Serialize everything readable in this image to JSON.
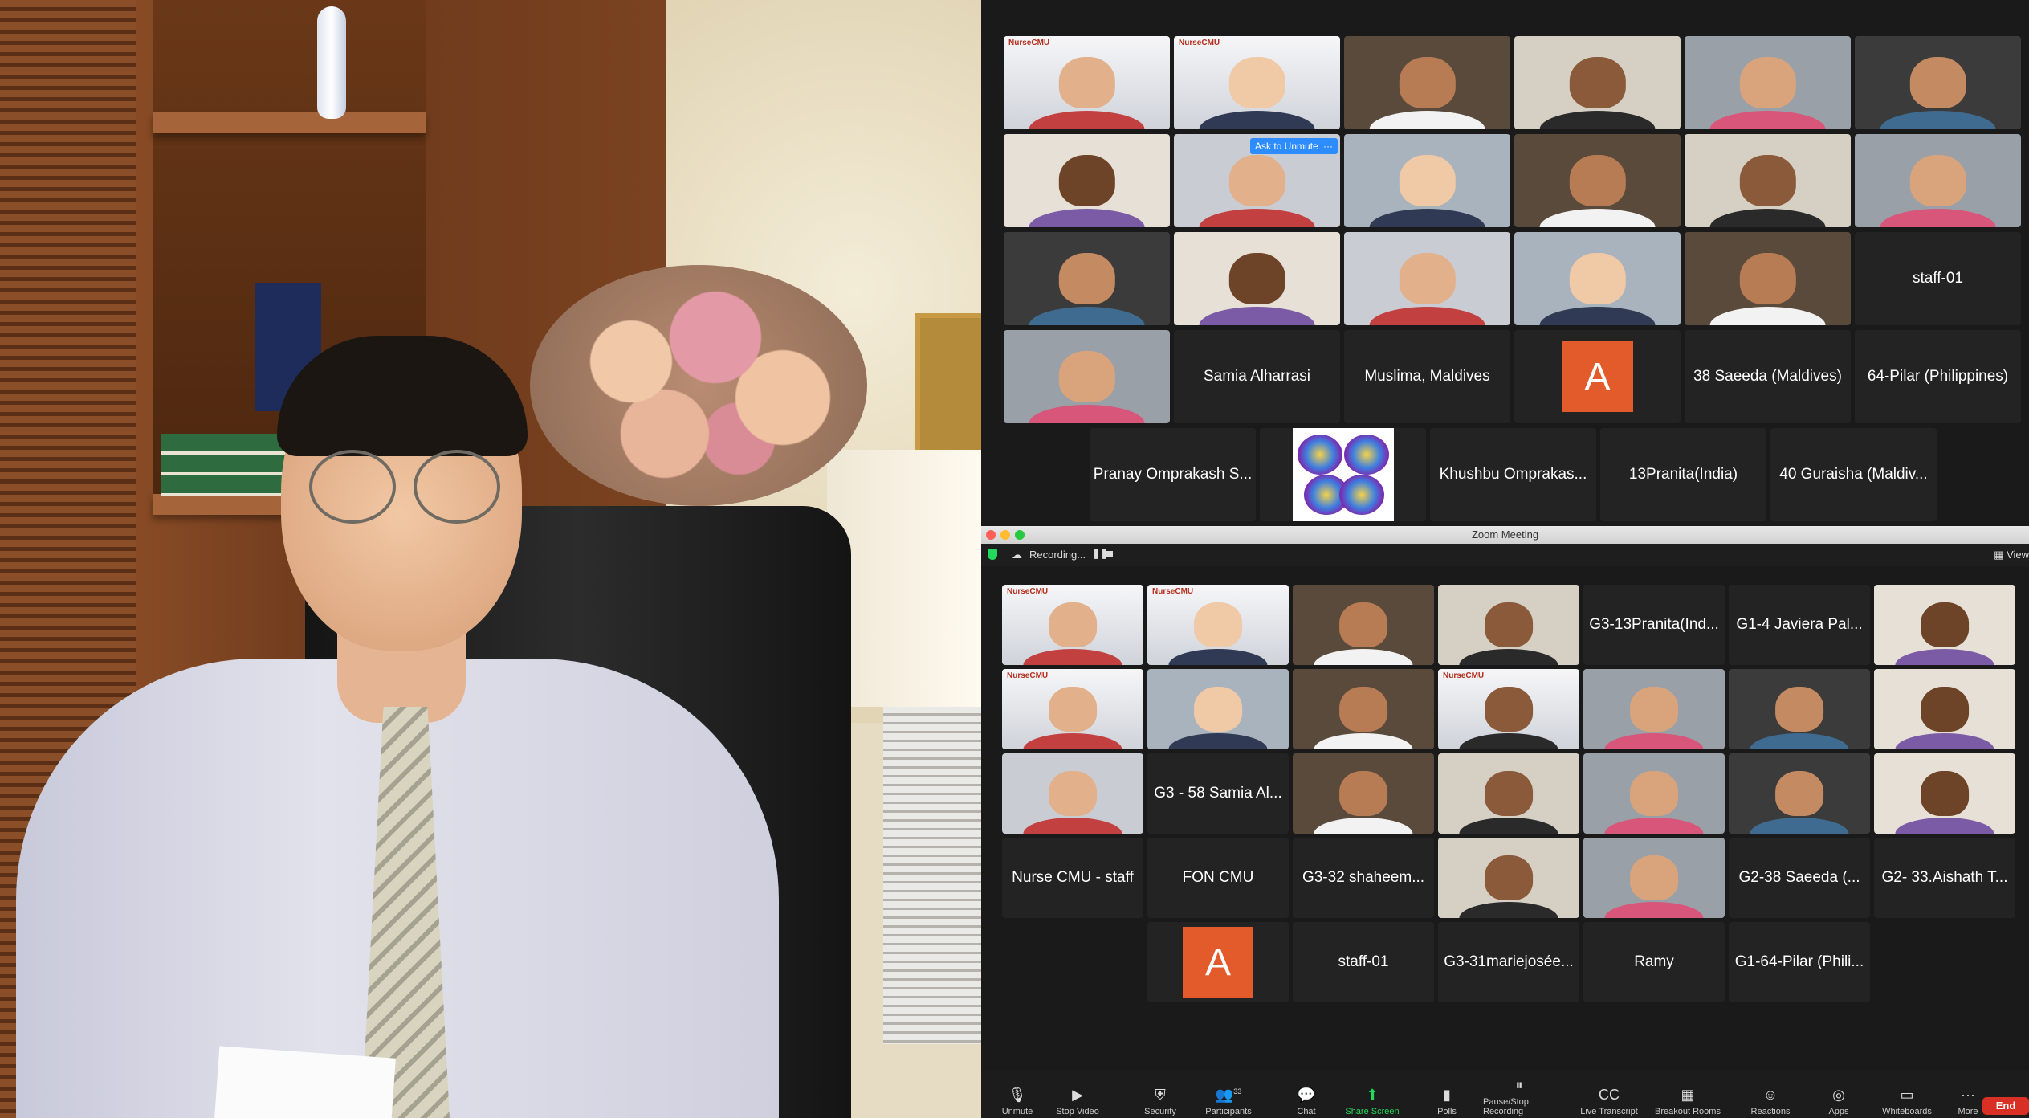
{
  "top_gallery": {
    "tiles": [
      {
        "name": ""
      },
      {
        "name": ""
      },
      {
        "name": ""
      },
      {
        "name": ""
      },
      {
        "name": ""
      },
      {
        "name": ""
      },
      {
        "name": ""
      },
      {
        "name": "",
        "ask_unmute": "Ask to Unmute",
        "more": "···"
      },
      {
        "name": ""
      },
      {
        "name": ""
      },
      {
        "name": ""
      },
      {
        "name": ""
      },
      {
        "name": ""
      },
      {
        "name": ""
      },
      {
        "name": ""
      },
      {
        "name": ""
      },
      {
        "name": ""
      },
      {
        "name": "staff-01"
      },
      {
        "name": ""
      },
      {
        "name": "Samia Alharrasi"
      },
      {
        "name": "Muslima, Maldives"
      },
      {
        "name": "",
        "avatar_letter": "A"
      },
      {
        "name": "38 Saeeda (Maldives)"
      },
      {
        "name": "64-Pilar (Philippines)"
      },
      {
        "name": "Pranay Omprakash S..."
      },
      {
        "name": ""
      },
      {
        "name": "Khushbu Omprakas..."
      },
      {
        "name": "13Pranita(India)"
      },
      {
        "name": "40 Guraisha (Maldiv..."
      }
    ]
  },
  "window": {
    "title": "Zoom Meeting",
    "recording_label": "Recording...",
    "view_label": "View",
    "pause_icon": "pause-icon",
    "stop_icon": "stop-icon"
  },
  "bottom_gallery": {
    "tiles": [
      {
        "name": ""
      },
      {
        "name": ""
      },
      {
        "name": ""
      },
      {
        "name": ""
      },
      {
        "name": "G3-13Pranita(Ind..."
      },
      {
        "name": "G1-4 Javiera Pal..."
      },
      {
        "name": ""
      },
      {
        "name": ""
      },
      {
        "name": ""
      },
      {
        "name": ""
      },
      {
        "name": ""
      },
      {
        "name": ""
      },
      {
        "name": ""
      },
      {
        "name": ""
      },
      {
        "name": ""
      },
      {
        "name": "G3 - 58 Samia Al..."
      },
      {
        "name": ""
      },
      {
        "name": ""
      },
      {
        "name": ""
      },
      {
        "name": ""
      },
      {
        "name": ""
      },
      {
        "name": "Nurse CMU - staff"
      },
      {
        "name": "FON CMU"
      },
      {
        "name": "G3-32 shaheem..."
      },
      {
        "name": ""
      },
      {
        "name": ""
      },
      {
        "name": "G2-38 Saeeda (..."
      },
      {
        "name": "G2- 33.Aishath T..."
      },
      {
        "name": "",
        "avatar_letter": "A"
      },
      {
        "name": "staff-01"
      },
      {
        "name": "G3-31mariejosée..."
      },
      {
        "name": "Ramy"
      },
      {
        "name": "G1-64-Pilar (Phili..."
      }
    ]
  },
  "brand_logo_text": "NurseCMU",
  "toolbar": {
    "items": [
      {
        "label": "Unmute",
        "icon": "mic-muted-icon",
        "glyph": "🎙"
      },
      {
        "label": "Stop Video",
        "icon": "video-icon",
        "glyph": "▶"
      },
      {
        "label": "Security",
        "icon": "shield-icon",
        "glyph": "⛨"
      },
      {
        "label": "Participants",
        "icon": "participants-icon",
        "glyph": "👥",
        "count": "33"
      },
      {
        "label": "Chat",
        "icon": "chat-icon",
        "glyph": "💬"
      },
      {
        "label": "Share Screen",
        "icon": "share-screen-icon",
        "glyph": "⬆"
      },
      {
        "label": "Polls",
        "icon": "polls-icon",
        "glyph": "▮"
      },
      {
        "label": "Pause/Stop Recording",
        "icon": "recording-icon",
        "glyph": "⏸"
      },
      {
        "label": "Live Transcript",
        "icon": "cc-icon",
        "glyph": "CC"
      },
      {
        "label": "Breakout Rooms",
        "icon": "breakout-icon",
        "glyph": "▦"
      },
      {
        "label": "Reactions",
        "icon": "reactions-icon",
        "glyph": "☺"
      },
      {
        "label": "Apps",
        "icon": "apps-icon",
        "glyph": "◎"
      },
      {
        "label": "Whiteboards",
        "icon": "whiteboard-icon",
        "glyph": "▭"
      },
      {
        "label": "More",
        "icon": "more-icon",
        "glyph": "···"
      }
    ],
    "end_label": "End"
  },
  "colors": {
    "active_speaker": "#23d95c",
    "avatar_a": "#e35a2b",
    "end_button": "#d93025",
    "ask_unmute": "#2d8cff"
  }
}
